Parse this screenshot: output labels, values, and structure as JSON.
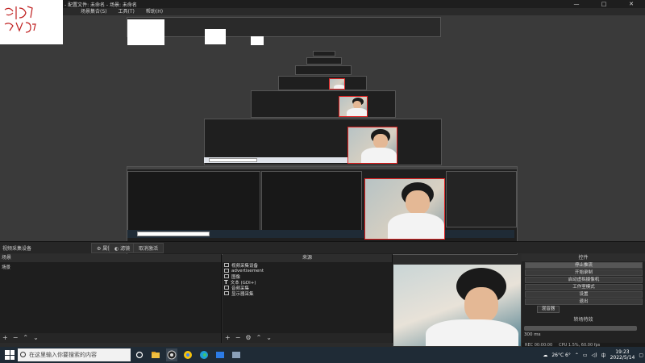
{
  "window": {
    "title": "- 配置文件: 未命名 - 场景: 未命名",
    "controls": [
      "—",
      "□",
      "✕"
    ]
  },
  "menu": [
    "场景集合(S)",
    "工具(T)",
    "帮助(H)"
  ],
  "logo_text": "编边王 欧人驻",
  "nested": {
    "docks_label_left": "场景",
    "docks_label_mid": "来源",
    "search_placeholder": "在这里输入你要搜索的内容"
  },
  "source_bar": {
    "label": "视频采集设备",
    "props_button": "⚙ 属性",
    "filter_button": "◐ 滤镜",
    "deactivate_button": "取消激活"
  },
  "scenes_dock": {
    "header": "场景",
    "items": [
      "场景"
    ]
  },
  "sources_dock": {
    "header": "来源",
    "items": [
      {
        "icon": "camera-icon",
        "label": "视频采集设备"
      },
      {
        "icon": "image-icon",
        "label": "advertisement"
      },
      {
        "icon": "image-icon",
        "label": "图像"
      },
      {
        "icon": "text-icon",
        "label": "文本 (GDI+)"
      },
      {
        "icon": "audio-icon",
        "label": "音频采集"
      },
      {
        "icon": "monitor-icon",
        "label": "显示器采集"
      }
    ]
  },
  "controls": {
    "header": "控件",
    "buttons": [
      "停止推流",
      "开始录制",
      "启动虚拟摄像机",
      "工作室模式",
      "设置",
      "退出"
    ]
  },
  "mixer": {
    "tab": "混音器",
    "header": "转场特效",
    "duration": "300 ms"
  },
  "status": {
    "rec": "REC 00:00:00",
    "cpu": "CPU 1.5%, 60.00 fps"
  },
  "taskbar": {
    "search_placeholder": "在这里输入你要搜索的内容",
    "weather": "26°C 6°",
    "ime": "中",
    "time": "19:23",
    "date": "2022/5/14"
  },
  "colors": {
    "accent_red": "#e02020",
    "panel_bg": "#1e1e1e",
    "taskbar_bg": "#1f2b36"
  }
}
